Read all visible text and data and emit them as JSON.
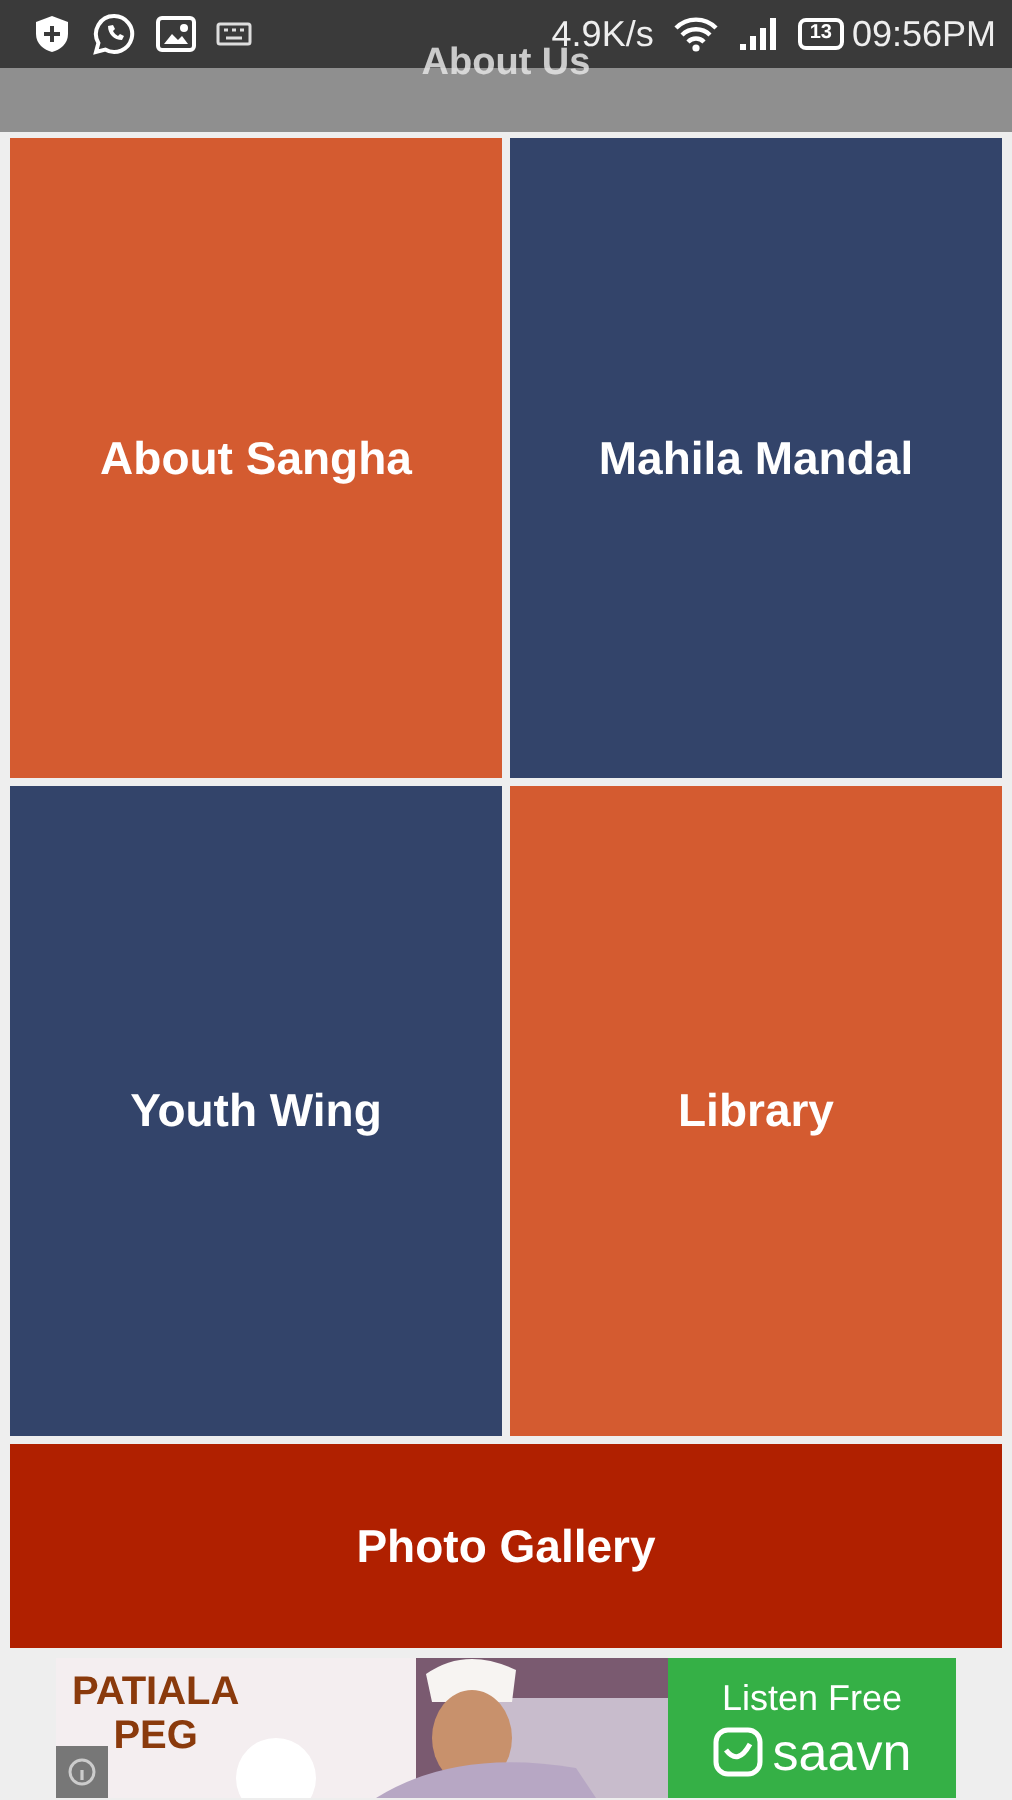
{
  "status_bar": {
    "speed": "4.9K/s",
    "battery": "13",
    "time": "09:56PM"
  },
  "title": "About Us",
  "tiles": [
    {
      "label": "About Sangha",
      "color": "#d45b30"
    },
    {
      "label": "Mahila Mandal",
      "color": "#33446a"
    },
    {
      "label": "Youth Wing",
      "color": "#33446a"
    },
    {
      "label": "Library",
      "color": "#d45b30"
    }
  ],
  "gallery": {
    "label": "Photo Gallery",
    "color": "#b02000"
  },
  "ad": {
    "kind": "picture",
    "headline": [
      "PATIALA",
      "PEG"
    ],
    "cta": "Listen Free",
    "brand": "saavn"
  }
}
